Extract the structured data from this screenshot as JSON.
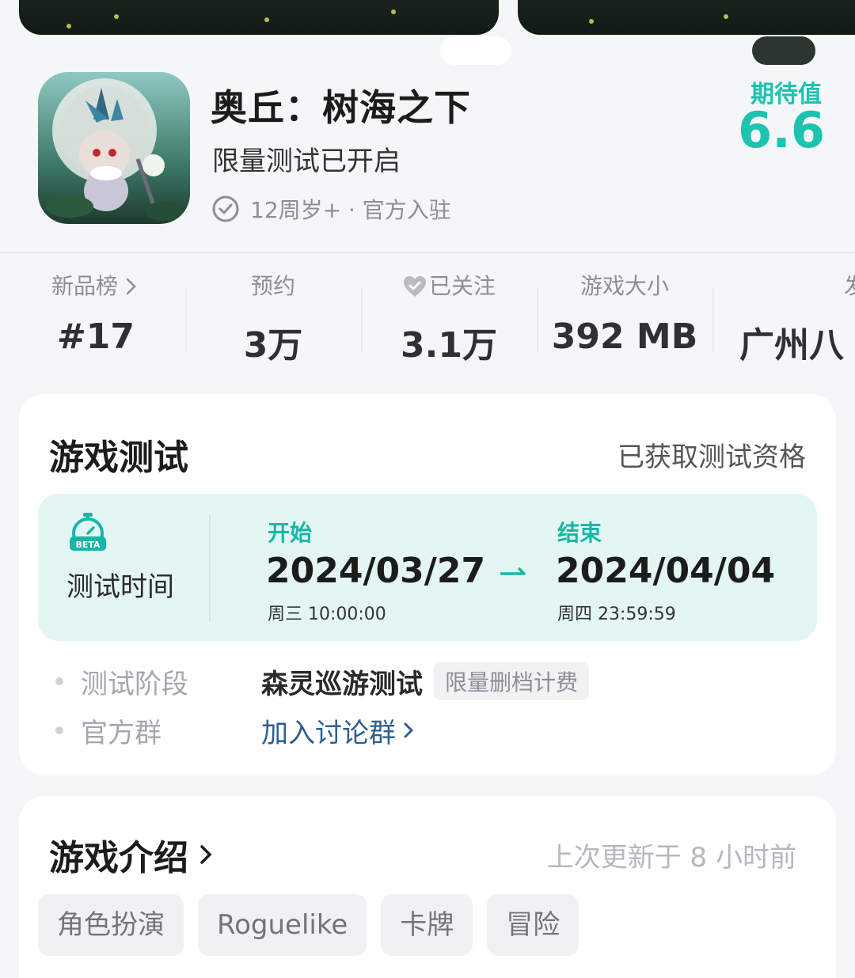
{
  "game": {
    "title": "奥丘：树海之下",
    "subtitle": "限量测试已开启",
    "meta": "12周岁+ · 官方入驻",
    "expect_label": "期待值",
    "expect_value": "6.6"
  },
  "stats": [
    {
      "label": "新品榜",
      "value": "#17",
      "icon": "chevron-right-icon"
    },
    {
      "label": "预约",
      "value": "3万"
    },
    {
      "label": "已关注",
      "value": "3.1万",
      "icon": "heart-icon"
    },
    {
      "label": "游戏大小",
      "value": "392 MB"
    },
    {
      "label": "发",
      "value": "广州八"
    }
  ],
  "test_card": {
    "title": "游戏测试",
    "status": "已获取测试资格",
    "time_label": "测试时间",
    "beta_icon_text": "BETA",
    "start_label": "开始",
    "start_date": "2024/03/27",
    "start_sub": "周三  10:00:00",
    "end_label": "结束",
    "end_date": "2024/04/04",
    "end_sub": "周四  23:59:59",
    "stage_key": "测试阶段",
    "stage_value": "森灵巡游测试",
    "stage_badge": "限量删档计费",
    "group_key": "官方群",
    "group_link": "加入讨论群"
  },
  "intro_card": {
    "title": "游戏介绍",
    "updated": "上次更新于 8 小时前",
    "tags": [
      "角色扮演",
      "Roguelike",
      "卡牌",
      "冒险"
    ]
  },
  "colors": {
    "accent": "#1bc3b0",
    "link": "#2d5f8f",
    "test_bg": "#e4f6f4"
  }
}
